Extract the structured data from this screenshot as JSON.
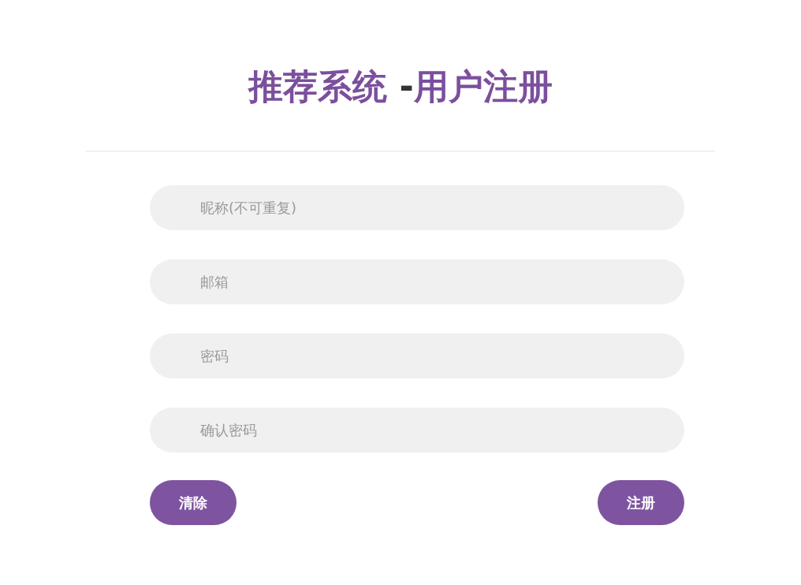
{
  "title": [
    {
      "text": "推荐系统 ",
      "kind": "accent"
    },
    {
      "text": "-",
      "kind": "dark"
    },
    {
      "text": "用户注册",
      "kind": "accent"
    }
  ],
  "fields": [
    {
      "placeholder": "昵称(不可重复)"
    },
    {
      "placeholder": "邮箱"
    },
    {
      "placeholder": "密码"
    },
    {
      "placeholder": "确认密码"
    }
  ],
  "buttons": [
    "清除",
    "注册"
  ]
}
